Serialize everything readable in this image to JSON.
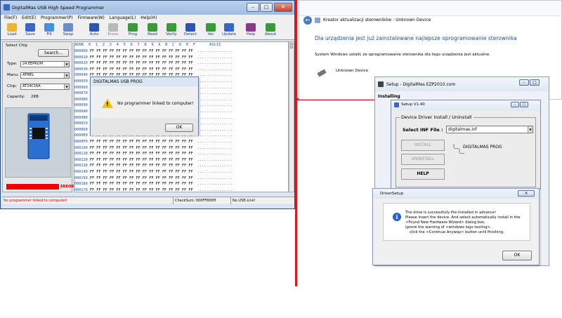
{
  "programmer": {
    "title": "DigitalMas USB High Speed Programmer",
    "menu": [
      "File(F)",
      "Edit(E)",
      "Programmer(P)",
      "Firmware(W)",
      "Language(L)",
      "Help(H)"
    ],
    "toolbar": [
      {
        "label": "Load",
        "icon": "folder-icon",
        "color": "#e8b53a",
        "disabled": false
      },
      {
        "label": "Save",
        "icon": "floppy-icon",
        "color": "#3a66c4",
        "disabled": false
      },
      {
        "label": "Fill",
        "icon": "fill-icon",
        "color": "#4a8fd8",
        "disabled": false
      },
      {
        "label": "Swap",
        "icon": "swap-icon",
        "color": "#6b8fc8",
        "disabled": false
      },
      {
        "label": "Auto",
        "icon": "auto-icon",
        "color": "#2c56b0",
        "disabled": false
      },
      {
        "label": "Erase",
        "icon": "erase-icon",
        "color": "#b9b9b9",
        "disabled": true
      },
      {
        "label": "Prog",
        "icon": "prog-icon",
        "color": "#3a9a3a",
        "disabled": false
      },
      {
        "label": "Read",
        "icon": "read-icon",
        "color": "#3a9a3a",
        "disabled": false
      },
      {
        "label": "Verify",
        "icon": "verify-icon",
        "color": "#3a9a3a",
        "disabled": false
      },
      {
        "label": "Detect",
        "icon": "detect-icon",
        "color": "#2c56b0",
        "disabled": false
      },
      {
        "label": "Ver",
        "icon": "version-icon",
        "color": "#3a9a3a",
        "disabled": false
      },
      {
        "label": "Update",
        "icon": "update-icon",
        "color": "#3a66c4",
        "disabled": false
      },
      {
        "label": "Help",
        "icon": "help-book-icon",
        "color": "#8a3a8a",
        "disabled": false
      },
      {
        "label": "About",
        "icon": "about-icon",
        "color": "#3a9a3a",
        "disabled": false
      }
    ],
    "select_chip_label": "Select Chip",
    "search_button": "Search...",
    "type_label": "Type:",
    "type_value": "24 EEPROM",
    "manu_label": "Manu:",
    "manu_value": "ATMEL",
    "chip_label": "Chip:",
    "chip_value": "AT24C16A",
    "capacity_label": "Capacity:",
    "capacity_value": "2KB",
    "error_label": "ERROR",
    "hex_header": "ADDR  0  1  2  3  4  5  6  7  8  9  A  B  C  D  E  F      ASCII",
    "hex_rows": [
      "000000",
      "000010",
      "000020",
      "000030",
      "000040",
      "000050",
      "000060",
      "000070",
      "000080",
      "000090",
      "0000A0",
      "0000B0",
      "0000C0",
      "0000D0",
      "0000E0",
      "0000F0",
      "000100",
      "000110",
      "000120",
      "000130",
      "000140",
      "000150",
      "000160",
      "000170"
    ],
    "hex_bytes": "FF FF FF FF FF FF FF FF FF FF FF FF FF FF FF FF",
    "hex_ascii": "................",
    "status_message": "No programmer linked to computer!",
    "checksum": "CheckSum: 000FF800H",
    "usb_status": "No USB Link!"
  },
  "dialog": {
    "title": "DIGITALMAS USB PROG",
    "message": "No programmer linked to computer!",
    "ok_label": "OK"
  },
  "update_window": {
    "title": "Kreator aktualizacji sterowników - Unknown Device",
    "heading": "Dla urządzenia jest już zainstalowane najlepsze oprogramowanie sterownika",
    "body": "System Windows ustalił, że oprogramowanie sterownika dla tego urządzenia jest aktualne.",
    "device_name": "Unknown Device"
  },
  "setup": {
    "title": "Setup - DigitalMas EZP2010.com",
    "installing_label": "Installing",
    "inner_title": "Setup V1.40",
    "group_label": "Device Driver Install / Uninstall",
    "select_inf_label": "Select INF File :",
    "inf_value": "digitalmas.inf",
    "install_button": "INSTALL",
    "uninstall_button": "UNINSTALL",
    "help_button": "HELP",
    "tree_item": "DIGITALMAS PROG"
  },
  "driver_setup": {
    "title": "DriverSetup",
    "lines": [
      "The drive is successfully Pre-installed in advance!",
      "Please insert the device. And select automatically install in the",
      "<Found New Hardware Wizard> dialog box,",
      "ignore the warning of <windows logo testing>,",
      "click the <Continue Anyway> button until finishing."
    ],
    "ok_label": "OK"
  },
  "colors": {
    "accent_red": "#d81921",
    "error_red": "#ef0000",
    "link_blue": "#1e50a2"
  }
}
